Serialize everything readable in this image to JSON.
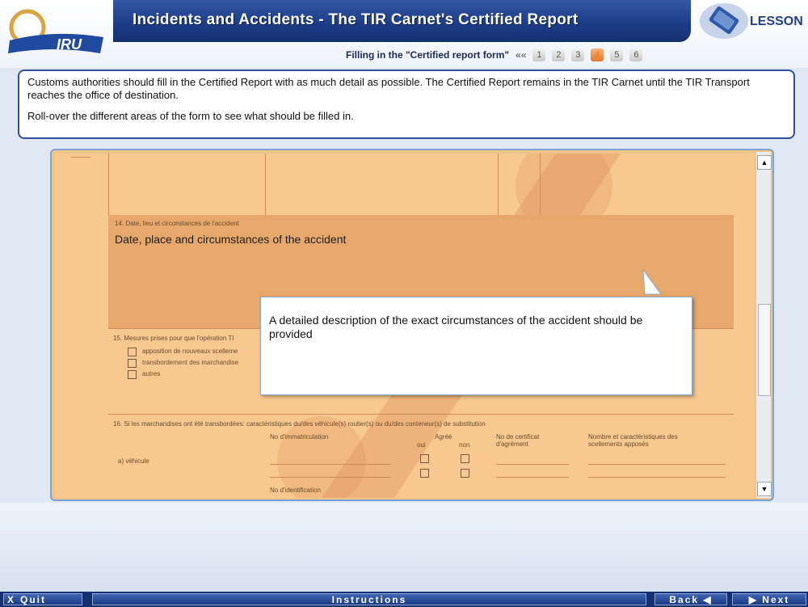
{
  "header": {
    "title": "Incidents and Accidents - The TIR Carnet's Certified Report",
    "logo_text": "IRU",
    "lesson_label": "LESSON",
    "subnav_title": "Filling in the \"Certified report form\"",
    "prev_symbol": "««",
    "pages": [
      "1",
      "2",
      "3",
      "4",
      "5",
      "6"
    ],
    "active_page": "4"
  },
  "intro": {
    "paragraph1": "Customs authorities should fill in the Certified Report with as much detail as possible. The Certified Report remains in the TIR Carnet until the TIR Transport reaches the office of destination.",
    "paragraph2": "Roll-over the different areas of the form to see what should be filled in."
  },
  "form": {
    "s14_label": "14. Date, lieu et circonstances de l'accident",
    "s14_value": "Date, place and circumstances of the accident",
    "s15_label": "15. Mesures prises pour que l'opération TI",
    "s15_options": [
      "apposition de nouveaux scelleme",
      "transbordement des marchandise",
      "autres"
    ],
    "s16_label": "16. Si les marchandises ont été transbordées: caractéristiques du/des véhicule(s) routier(s) ou du/des conteneur(s) de substitution",
    "col_immat": "No d'immatriculation",
    "col_agree": "Agréé",
    "col_oui": "oui",
    "col_non": "non",
    "col_cert": "No de certificat d'agrément",
    "col_nombre": "Nombre et caractéristiques des scellements apposés",
    "row_vehicule": "a) véhicule",
    "row_ident": "No d'identification"
  },
  "tooltip": {
    "text": "A detailed description of the exact circumstances of the accident should be provided"
  },
  "footer": {
    "quit_icon": "X",
    "quit_label": "Quit",
    "instructions_label": "Instructions",
    "back_label": "Back",
    "next_label": "Next"
  },
  "colors": {
    "brand_blue": "#1b3b86",
    "form_orange": "#f7c990",
    "highlight": "#e7a86b",
    "active_page": "#e27a2c"
  }
}
